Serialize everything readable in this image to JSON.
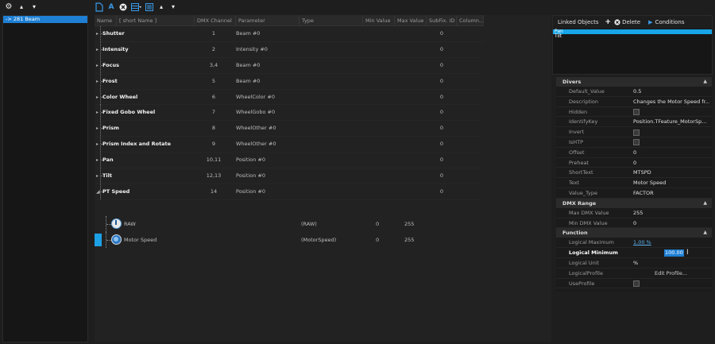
{
  "left": {
    "items": [
      {
        "label": "-> 281 Beam",
        "selected": true
      }
    ]
  },
  "grid": {
    "headers": [
      "Name",
      "[ short Name ]",
      "DMX Channel",
      "Parameter",
      "Type",
      "Min Value",
      "Max Value",
      "SubFix. ID",
      "Column..."
    ],
    "rows": [
      {
        "name": "Shutter",
        "dmx": "1",
        "param": "Beam #0",
        "subfix": "0"
      },
      {
        "name": "Intensity",
        "dmx": "2",
        "param": "Intensity #0",
        "subfix": "0"
      },
      {
        "name": "Focus",
        "dmx": "3,4",
        "param": "Beam #0",
        "subfix": "0"
      },
      {
        "name": "Frost",
        "dmx": "5",
        "param": "Beam #0",
        "subfix": "0"
      },
      {
        "name": "Color Wheel",
        "dmx": "6",
        "param": "WheelColor #0",
        "subfix": "0"
      },
      {
        "name": "Fixed Gobo Wheel",
        "dmx": "7",
        "param": "WheelGobo #0",
        "subfix": "0"
      },
      {
        "name": "Prism",
        "dmx": "8",
        "param": "WheelOther #0",
        "subfix": "0"
      },
      {
        "name": "Prism Index and Rotate",
        "dmx": "9",
        "param": "WheelOther #0",
        "subfix": "0"
      },
      {
        "name": "Pan",
        "dmx": "10,11",
        "param": "Position #0",
        "subfix": "0"
      },
      {
        "name": "Tilt",
        "dmx": "12,13",
        "param": "Position #0",
        "subfix": "0"
      },
      {
        "name": "PT Speed",
        "dmx": "14",
        "param": "Position #0",
        "subfix": "0",
        "expanded": true
      }
    ],
    "children": [
      {
        "name": "RAW",
        "type": "(RAW)",
        "min": "0",
        "max": "255"
      },
      {
        "name": "Motor Speed",
        "type": "(MotorSpeed)",
        "min": "0",
        "max": "255"
      }
    ]
  },
  "linked": {
    "title": "Linked Objects",
    "delete_label": "Delete",
    "conditions_label": "Conditions",
    "items": [
      {
        "label": "Pan",
        "selected": true
      },
      {
        "label": "Tilt",
        "selected": false
      }
    ]
  },
  "props": {
    "divers": {
      "title": "Divers",
      "rows": [
        {
          "label": "Default_Value",
          "value": "0.5"
        },
        {
          "label": "Description",
          "value": "Changes the Motor Speed fr..."
        },
        {
          "label": "Hidden",
          "check": true
        },
        {
          "label": "IdentifyKey",
          "value": "Position.TFeature_MotorSp..."
        },
        {
          "label": "Invert",
          "check": true
        },
        {
          "label": "IsHTP",
          "check": true
        },
        {
          "label": "Offset",
          "value": "0"
        },
        {
          "label": "Preheat",
          "value": "0"
        },
        {
          "label": "ShortText",
          "value": "MTSPD"
        },
        {
          "label": "Text",
          "value": "Motor Speed"
        },
        {
          "label": "Value_Type",
          "value": "FACTOR"
        }
      ]
    },
    "dmx_range": {
      "title": "DMX Range",
      "rows": [
        {
          "label": "Max DMX Value",
          "value": "255"
        },
        {
          "label": "Min DMX Value",
          "value": "0"
        }
      ]
    },
    "function": {
      "title": "Function",
      "logical_maximum_label": "Logical Maximum",
      "logical_maximum_value": "1.00 %",
      "logical_minimum_label": "Logical Minimum",
      "logical_minimum_value": "100.00",
      "logical_unit_label": "Logical Unit",
      "logical_unit_value": "%",
      "logical_profile_label": "LogicalProfile",
      "logical_profile_value": "Edit Profile...",
      "use_profile_label": "UseProfile"
    }
  }
}
